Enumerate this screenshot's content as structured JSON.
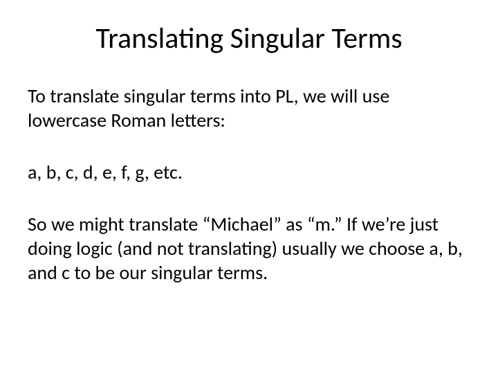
{
  "slide": {
    "title": "Translating Singular Terms",
    "paragraphs": [
      "To translate singular terms into PL, we will use lowercase Roman letters:",
      "a, b, c, d, e, f, g, etc.",
      "So we might translate “Michael” as “m.” If we’re just doing logic (and not translating) usually we choose a, b, and c to be our singular terms."
    ]
  }
}
